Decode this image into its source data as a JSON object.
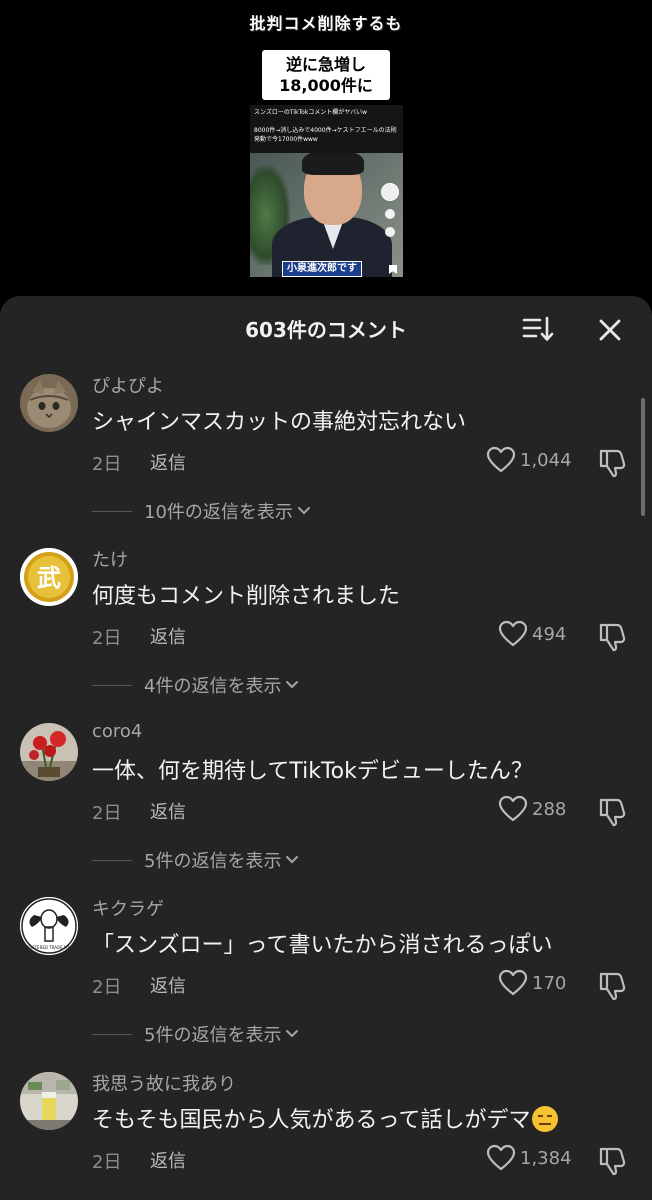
{
  "video": {
    "top_caption": "批判コメ削除するも",
    "headline_line1": "逆に急増し",
    "headline_line2": "18,000件に",
    "thumb_title": "スンズローのTikTokコメント欄がヤバいw",
    "thumb_sub": "8000件→消し込みで4000件→ケストフエールの法則発動で今17000件www",
    "thumb_name": "小泉進次郎です"
  },
  "sheet": {
    "title": "603件のコメント",
    "sort_icon": "sort-icon",
    "close_icon": "close-icon"
  },
  "comments": [
    {
      "user": "ぴよぴよ",
      "text": "シャインマスカットの事絶対忘れない",
      "ago": "2日",
      "reply": "返信",
      "likes": "1,044",
      "replies": "10件の返信を表示",
      "avatar": "cat-photo"
    },
    {
      "user": "たけ",
      "text": "何度もコメント削除されました",
      "ago": "2日",
      "reply": "返信",
      "likes": "494",
      "replies": "4件の返信を表示",
      "avatar": "kanji-badge",
      "avatar_char": "武"
    },
    {
      "user": "coro4",
      "text": "一体、何を期待してTikTokデビューしたん？",
      "ago": "2日",
      "reply": "返信",
      "likes": "288",
      "replies": "5件の返信を表示",
      "avatar": "flower-photo"
    },
    {
      "user": "キクラゲ",
      "text": "「スンズロー」って書いたから消されるっぽい",
      "ago": "2日",
      "reply": "返信",
      "likes": "170",
      "replies": "5件の返信を表示",
      "avatar": "trademark-logo",
      "avatar_text": "REGISTERED TRADE MARK"
    },
    {
      "user": "我思う故に我あり",
      "text": "そもそも国民から人気があるって話しがデマ",
      "ago": "2日",
      "reply": "返信",
      "likes": "1,384",
      "replies": "",
      "avatar": "drink-photo",
      "emoji": "expressionless-face"
    }
  ]
}
